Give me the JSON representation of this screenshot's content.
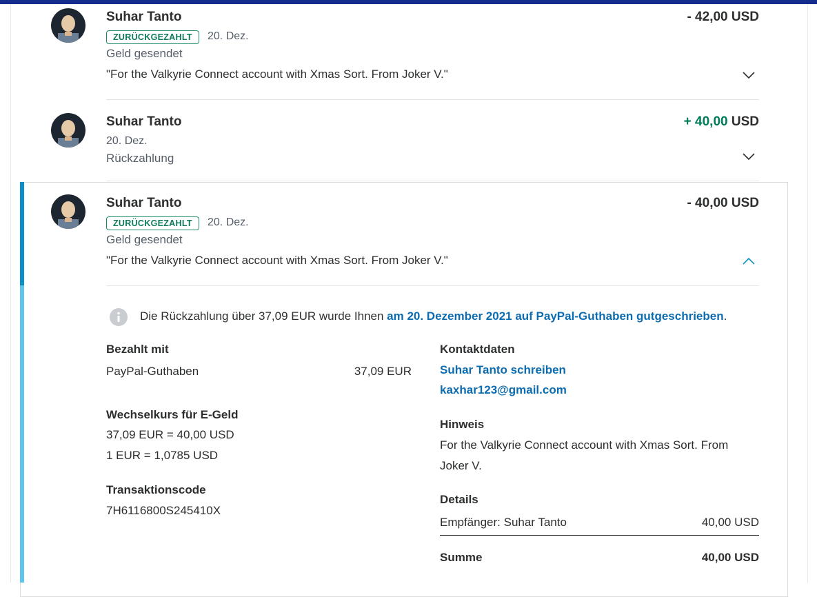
{
  "colors": {
    "topbar": "#142c8e",
    "accent_dark": "#0c8fc7",
    "accent_light": "#5cc6ef",
    "positive": "#017a5a",
    "badge": "#1b8a6b",
    "link": "#0d6cb0"
  },
  "transactions": [
    {
      "name": "Suhar Tanto",
      "amount": "- 42,00 USD",
      "status_badge": "ZURÜCKGEZAHLT",
      "date": "20. Dez.",
      "type": "Geld gesendet",
      "note": "\"For the Valkyrie Connect account with Xmas Sort. From Joker V.\"",
      "chevron": "chevron-down-icon"
    },
    {
      "name": "Suhar Tanto",
      "amount_value": "+ 40,00",
      "amount_currency": "USD",
      "date": "20. Dez.",
      "type": "Rückzahlung",
      "chevron": "chevron-down-icon"
    },
    {
      "name": "Suhar Tanto",
      "amount": "- 40,00 USD",
      "status_badge": "ZURÜCKGEZAHLT",
      "date": "20. Dez.",
      "type": "Geld gesendet",
      "note": "\"For the Valkyrie Connect account with Xmas Sort. From Joker V.\"",
      "chevron": "chevron-up-icon"
    }
  ],
  "details": {
    "info_prefix": "Die Rückzahlung über 37,09 EUR wurde Ihnen ",
    "info_link": "am 20. Dezember 2021 auf PayPal-Guthaben gutgeschrieben",
    "info_suffix": ".",
    "paid_with_heading": "Bezahlt mit",
    "paid_with_source": "PayPal-Guthaben",
    "paid_with_amount": "37,09 EUR",
    "exchange_heading": "Wechselkurs für E-Geld",
    "exchange_line1": "37,09 EUR = 40,00 USD",
    "exchange_line2": "1 EUR = 1,0785 USD",
    "txn_heading": "Transaktionscode",
    "txn_code": "7H6116800S245410X",
    "contact_heading": "Kontaktdaten",
    "contact_write": "Suhar Tanto schreiben",
    "contact_email": "kaxhar123@gmail.com",
    "hint_heading": "Hinweis",
    "hint_line1": "For the Valkyrie Connect account with Xmas Sort. From",
    "hint_line2": "Joker V.",
    "details_heading": "Details",
    "recipient_label": "Empfänger: Suhar Tanto",
    "recipient_amount": "40,00 USD",
    "total_label": "Summe",
    "total_amount": "40,00 USD"
  }
}
